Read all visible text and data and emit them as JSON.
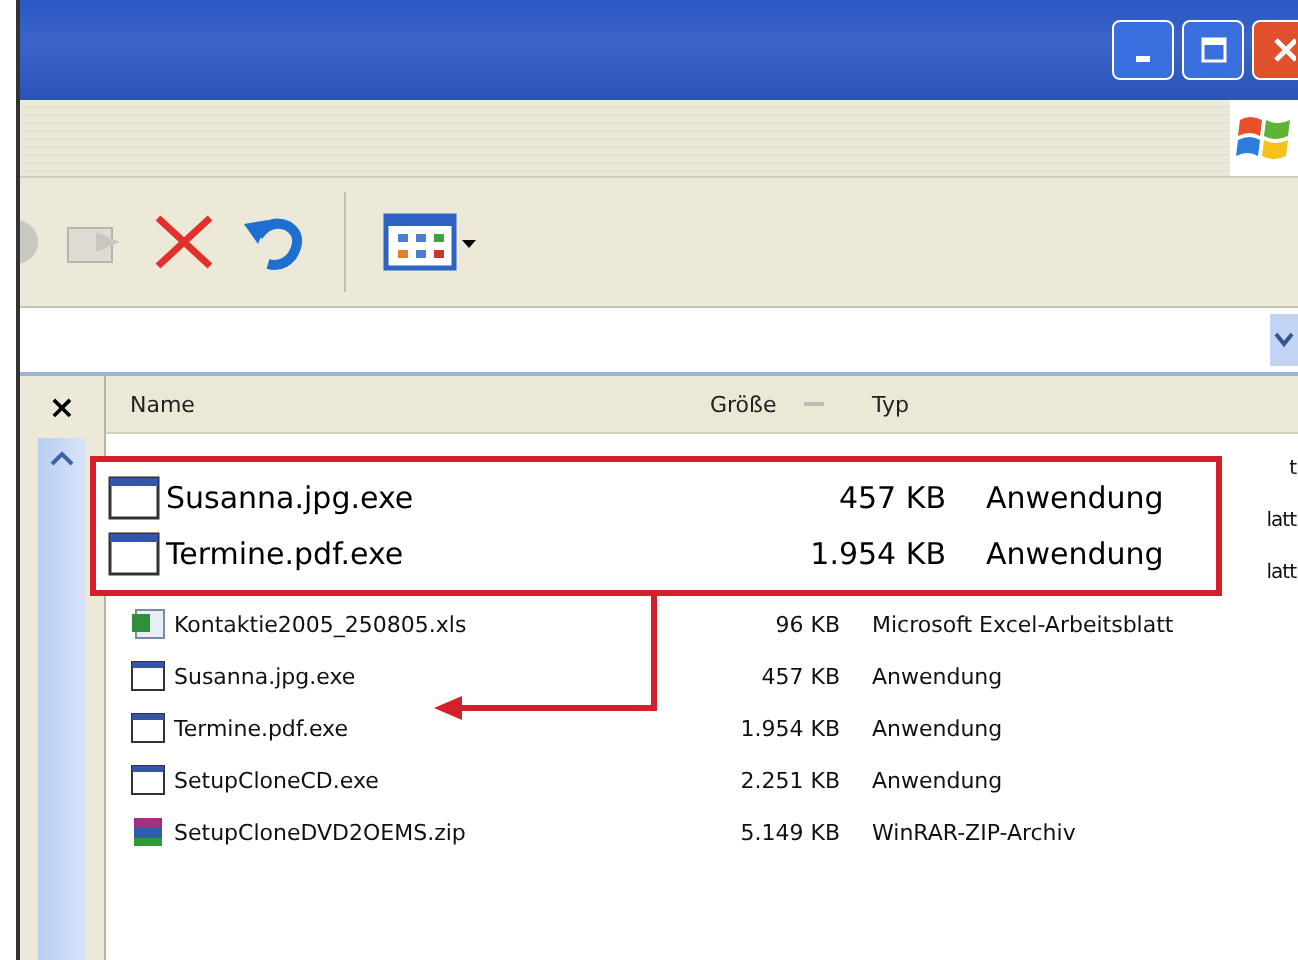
{
  "toolbar": {
    "buttons": [
      {
        "kind": "forward"
      },
      {
        "kind": "move"
      },
      {
        "kind": "delete"
      },
      {
        "kind": "undo"
      },
      {
        "kind": "views"
      }
    ]
  },
  "left_pane": {
    "close": "×"
  },
  "columns": [
    {
      "label": "Name"
    },
    {
      "label": "Größe"
    },
    {
      "label": "Typ"
    }
  ],
  "hidden_rows": [
    {
      "type": "t"
    },
    {
      "type": "latt"
    },
    {
      "type": "latt"
    }
  ],
  "files": [
    {
      "name": "Kontaktie2005_250805.xls",
      "size": "96 KB",
      "type": "Microsoft Excel-Arbeitsblatt",
      "kind": "excel"
    },
    {
      "name": "Susanna.jpg.exe",
      "size": "457 KB",
      "type": "Anwendung",
      "kind": "exe"
    },
    {
      "name": "Termine.pdf.exe",
      "size": "1.954 KB",
      "type": "Anwendung",
      "kind": "exe"
    },
    {
      "name": "SetupCloneCD.exe",
      "size": "2.251 KB",
      "type": "Anwendung",
      "kind": "exe"
    },
    {
      "name": "SetupCloneDVD2OEMS.zip",
      "size": "5.149 KB",
      "type": "WinRAR-ZIP-Archiv",
      "kind": "zip"
    }
  ],
  "callout": {
    "rows": [
      {
        "name": "Susanna.jpg.exe",
        "size": "457 KB",
        "type": "Anwendung",
        "kind": "exe"
      },
      {
        "name": "Termine.pdf.exe",
        "size": "1.954 KB",
        "type": "Anwendung",
        "kind": "exe"
      }
    ]
  }
}
